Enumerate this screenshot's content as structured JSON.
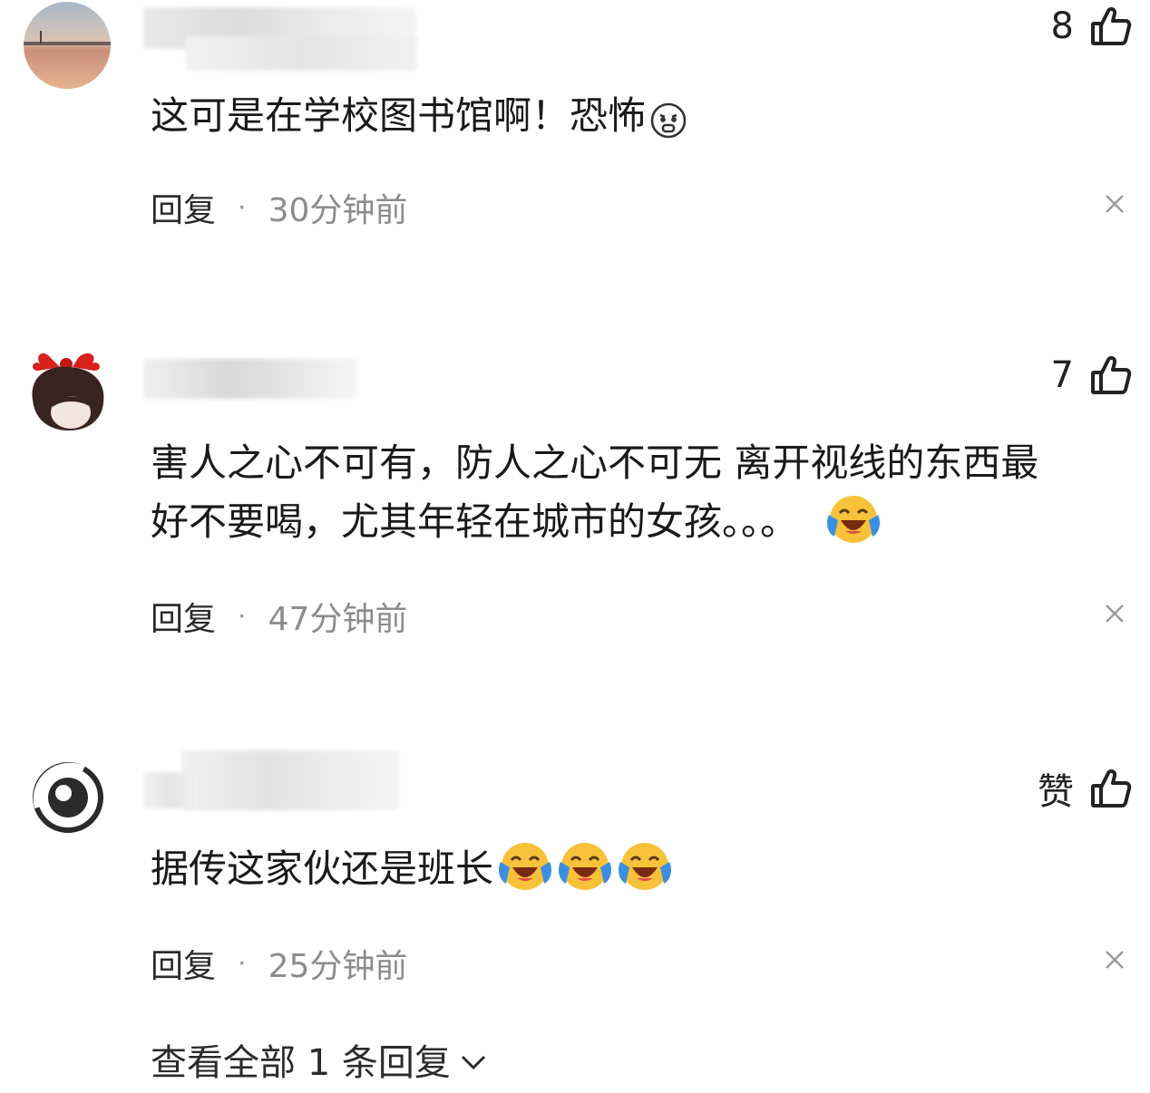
{
  "comments": [
    {
      "like_count": "8",
      "text": "这可是在学校图书馆啊！恐怖",
      "emoji": "fearful-face-icon",
      "reply_label": "回复",
      "separator": "·",
      "time": "30分钟前"
    },
    {
      "like_count": "7",
      "text_line1": "害人之心不可有，防人之心不可无 离开视线的东西最",
      "text_line2": "好不要喝，尤其年轻在城市的女孩。。。",
      "emoji": "laughing-crying-face-icon",
      "reply_label": "回复",
      "separator": "·",
      "time": "47分钟前"
    },
    {
      "like_count": "赞",
      "text": "据传这家伙还是班长",
      "emoji": "laughing-crying-face-icon",
      "reply_label": "回复",
      "separator": "·",
      "time": "25分钟前"
    }
  ],
  "view_all_replies": "查看全部 1 条回复",
  "colors": {
    "text": "#1a1a1a",
    "meta_gray": "#8c8c8c",
    "emoji_yellow": "#f7c23a",
    "emoji_blue": "#3b8fe0"
  }
}
